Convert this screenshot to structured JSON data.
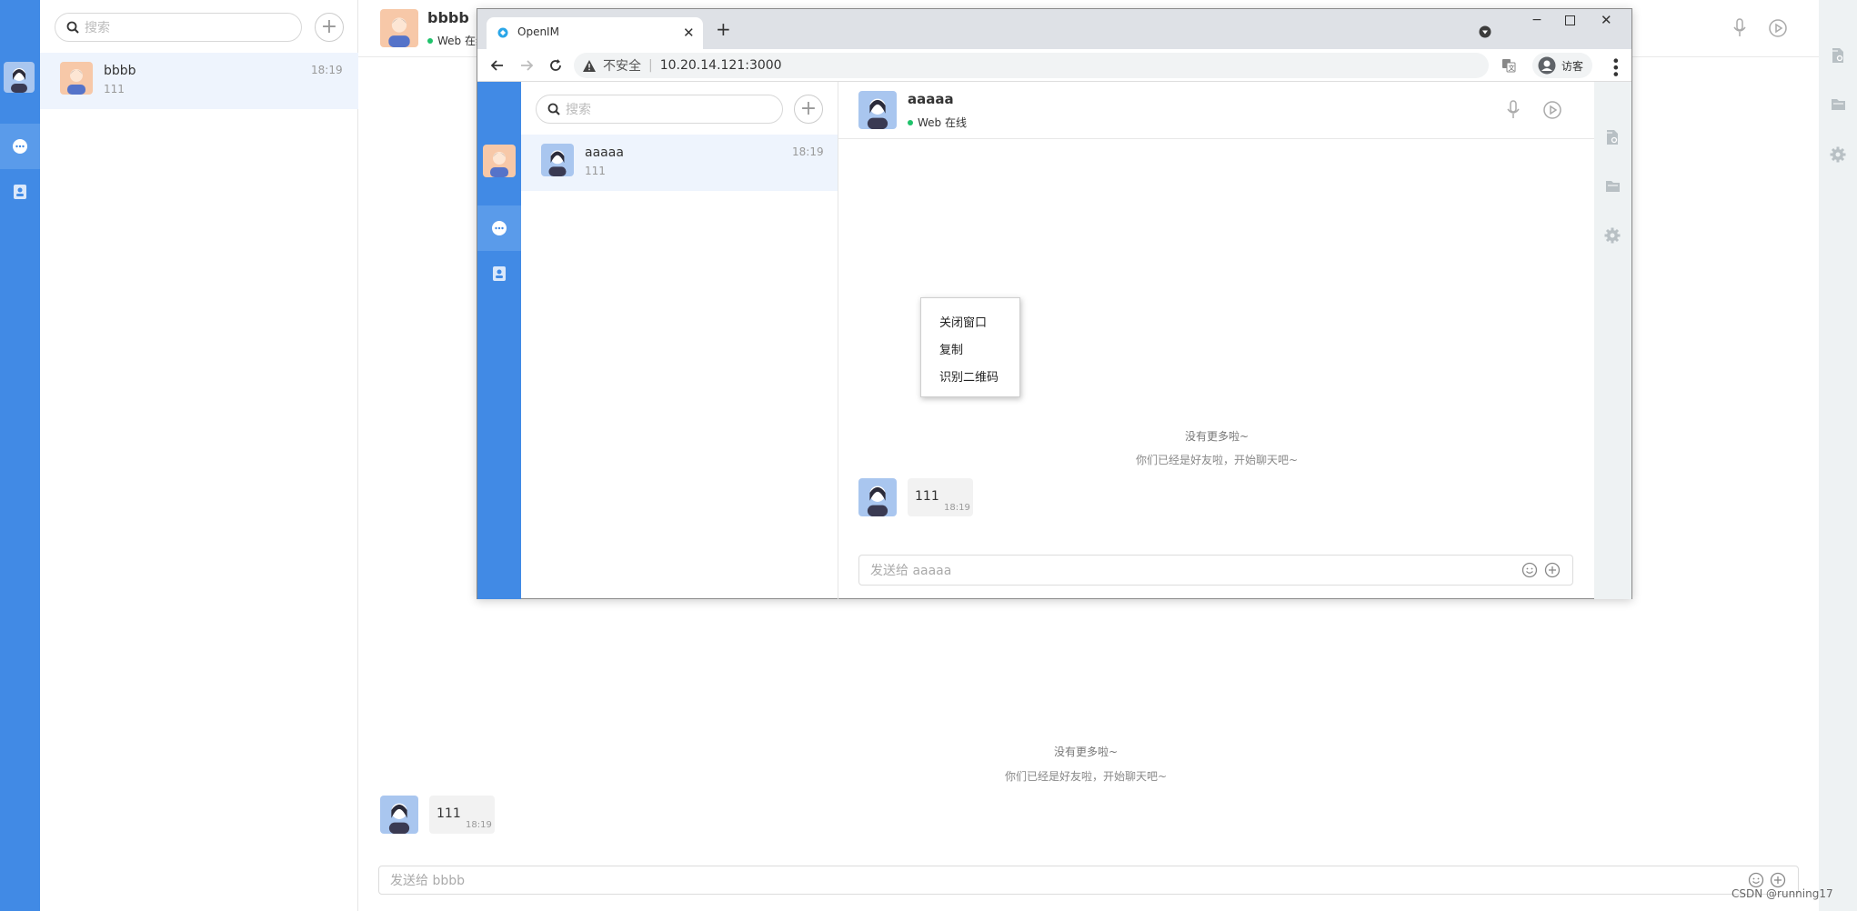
{
  "app": {
    "search_placeholder": "搜索",
    "conversation": {
      "name": "bbbb",
      "preview": "111",
      "time": "18:19"
    },
    "chat": {
      "title": "bbbb",
      "status": "Web 在线",
      "no_more": "没有更多啦~",
      "friends_hint": "你们已经是好友啦，开始聊天吧~",
      "message": {
        "text": "111",
        "time": "18:19"
      },
      "input_placeholder": "发送给 bbbb"
    }
  },
  "browser": {
    "tab_title": "OpenIM",
    "security_label": "不安全",
    "url": "10.20.14.121:3000",
    "profile_label": "访客",
    "app": {
      "search_placeholder": "搜索",
      "conversation": {
        "name": "aaaaa",
        "preview": "111",
        "time": "18:19"
      },
      "chat": {
        "title": "aaaaa",
        "status": "Web 在线",
        "no_more": "没有更多啦~",
        "friends_hint": "你们已经是好友啦，开始聊天吧~",
        "message": {
          "text": "111",
          "time": "18:19"
        },
        "input_placeholder": "发送给 aaaaa"
      },
      "context_menu": [
        "关闭窗口",
        "复制",
        "识别二维码"
      ]
    }
  },
  "watermark": "CSDN @running17",
  "colors": {
    "accent": "#418ae5",
    "selected_row": "#eef4fd",
    "online": "#1fc26b"
  }
}
